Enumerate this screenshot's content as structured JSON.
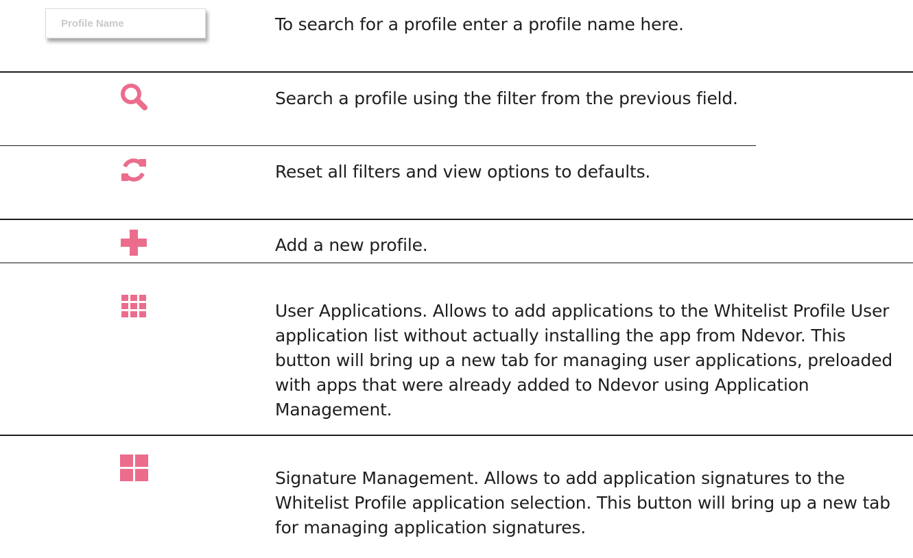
{
  "theme": {
    "accent": "#ec6c8c",
    "rule": "#1a1a1a"
  },
  "profile_field": {
    "placeholder": "Profile Name"
  },
  "rows": [
    {
      "icon": "text-input-field",
      "text": "To search for a profile enter a profile name here."
    },
    {
      "icon": "search-icon",
      "text": "Search a profile using the filter from the previous field."
    },
    {
      "icon": "refresh-icon",
      "text": "Reset all filters and view options to defaults."
    },
    {
      "icon": "plus-icon",
      "text": "Add a new profile."
    },
    {
      "icon": "app-grid-icon",
      "text": "User Applications. Allows to add applications to the Whitelist Profile User application list without actually installing the app from Ndevor. This button will bring up a new tab for managing user applications, preloaded with apps that were already added to Ndevor using Application Management."
    },
    {
      "icon": "tiles-icon",
      "text": "Signature Management. Allows to add application signatures to the Whitelist Profile application selection. This button will bring up a new tab for managing application signatures."
    }
  ]
}
